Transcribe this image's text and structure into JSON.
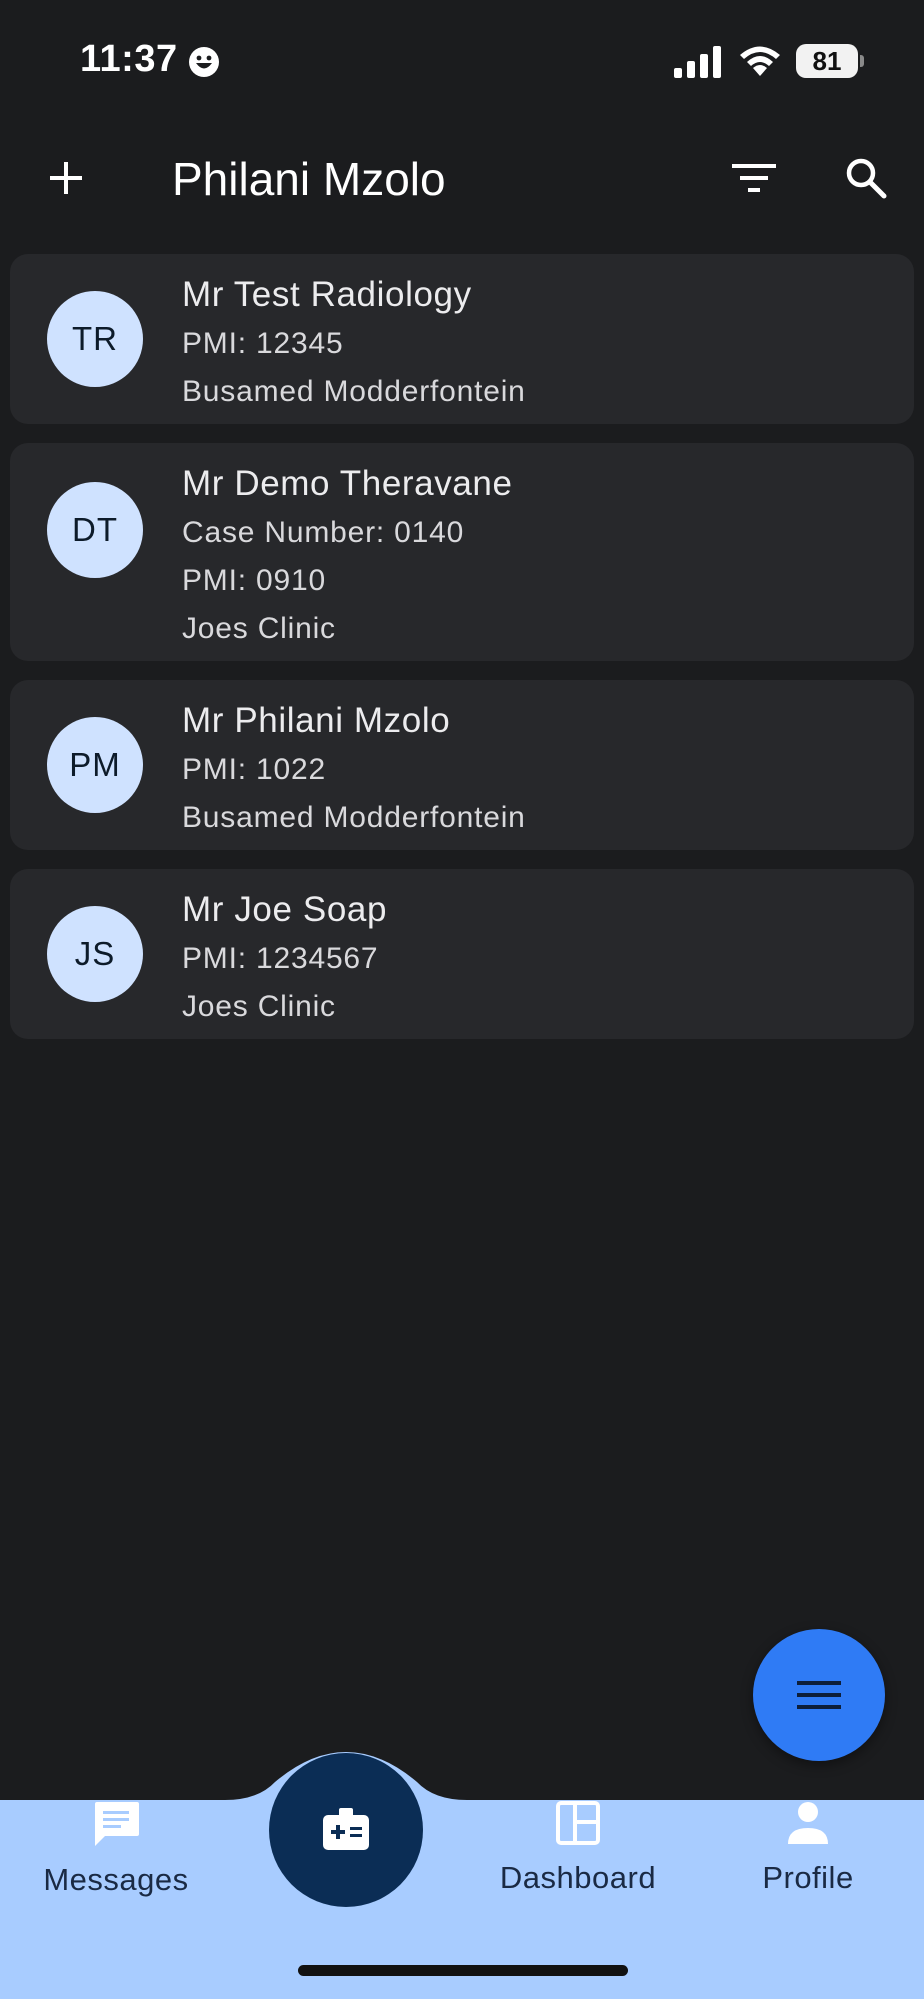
{
  "status_bar": {
    "time": "11:37",
    "battery": "81"
  },
  "app_bar": {
    "title": "Philani Mzolo"
  },
  "patients": [
    {
      "initials": "TR",
      "name": "Mr Test Radiology",
      "lines": [
        "PMI: 12345",
        "Busamed Modderfontein"
      ]
    },
    {
      "initials": "DT",
      "name": "Mr Demo Theravane",
      "lines": [
        "Case Number: 0140",
        "PMI: 0910",
        "Joes Clinic"
      ]
    },
    {
      "initials": "PM",
      "name": "Mr Philani Mzolo",
      "lines": [
        "PMI: 1022",
        "Busamed Modderfontein"
      ]
    },
    {
      "initials": "JS",
      "name": "Mr Joe Soap",
      "lines": [
        "PMI: 1234567",
        "Joes Clinic"
      ]
    }
  ],
  "bottom_nav": {
    "messages": "Messages",
    "dashboard": "Dashboard",
    "profile": "Profile"
  },
  "colors": {
    "background": "#1b1c1e",
    "card": "#27282b",
    "avatar": "#cfe2ff",
    "fab": "#2f7bf5",
    "nav": "#a8ccff",
    "nav_center": "#0b2d55"
  },
  "icons": {
    "add": "plus-icon",
    "filter": "filter-icon",
    "search": "search-icon",
    "fab": "menu-icon",
    "messages": "message-icon",
    "center": "medical-id-icon",
    "dashboard": "dashboard-icon",
    "profile": "person-icon"
  }
}
